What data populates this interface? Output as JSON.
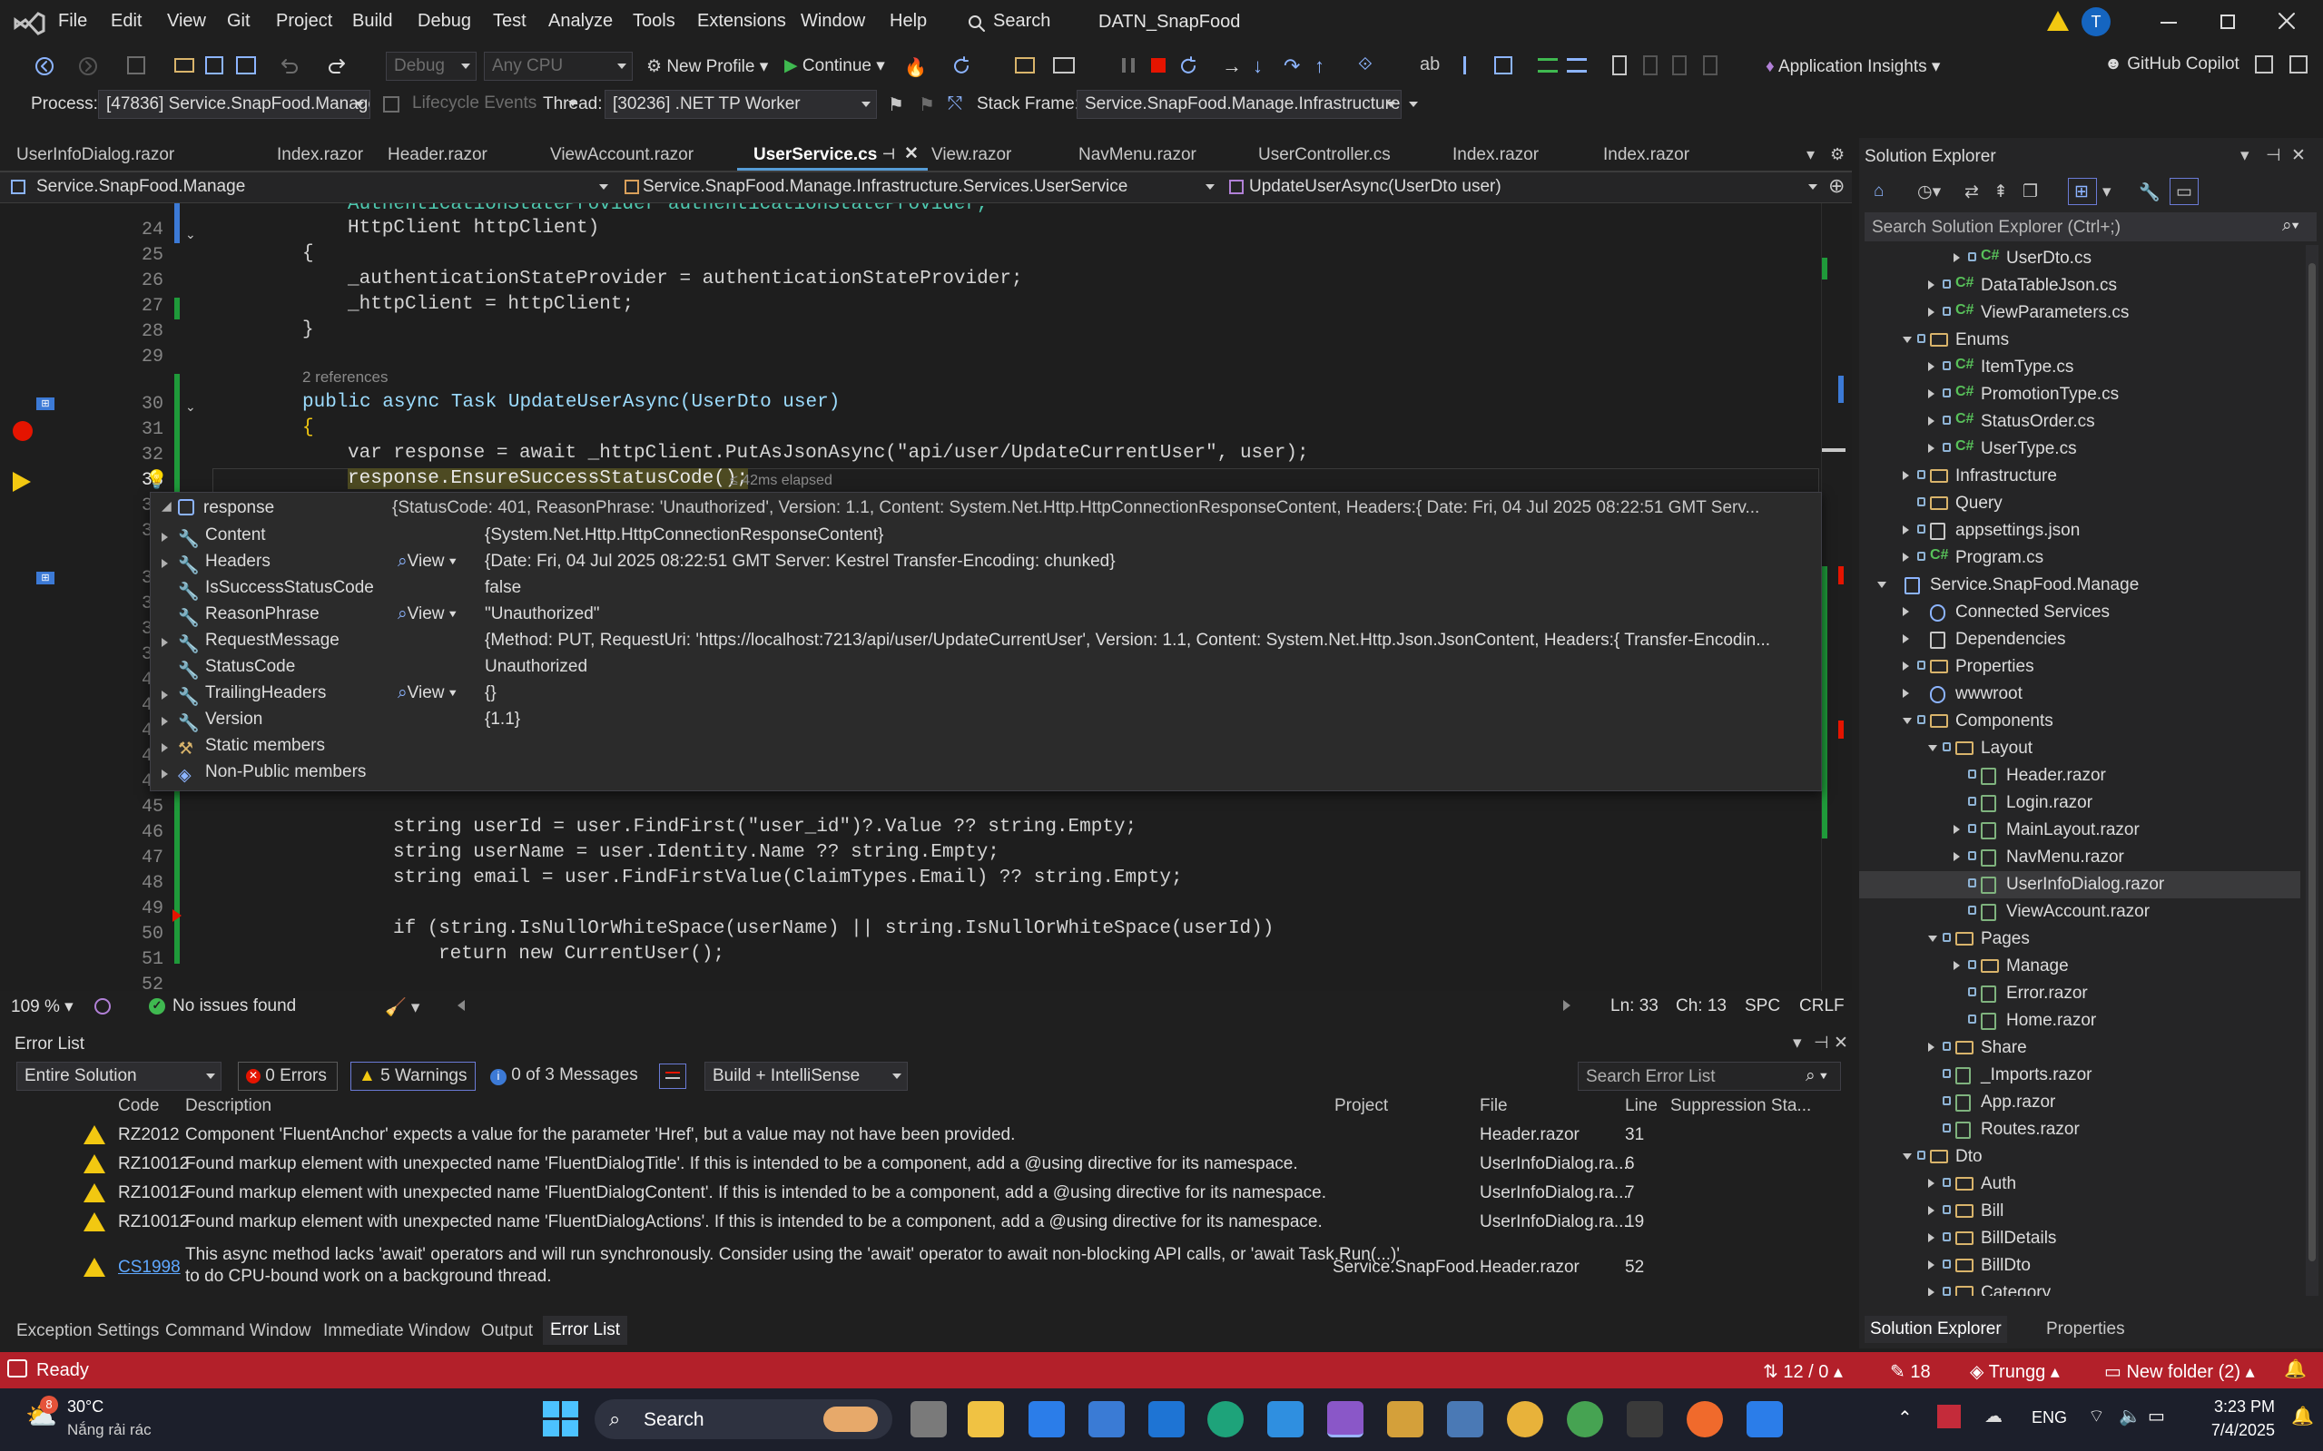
{
  "app": {
    "logo": "visual-studio-logo-icon",
    "solution_name": "DATN_SnapFood",
    "avatar_initial": "T",
    "search_label": "Search"
  },
  "menu": [
    "File",
    "Edit",
    "View",
    "Git",
    "Project",
    "Build",
    "Debug",
    "Test",
    "Analyze",
    "Tools",
    "Extensions",
    "Window",
    "Help"
  ],
  "toolbar": {
    "config": "Debug",
    "platform": "Any CPU",
    "profile": "New Profile",
    "continue": "Continue",
    "insights": "Application Insights",
    "copilot": "GitHub Copilot"
  },
  "debugbar": {
    "process_label": "Process:",
    "process": "[47836] Service.SnapFood.Manage",
    "lifecycle": "Lifecycle Events",
    "thread_label": "Thread:",
    "thread": "[30236] .NET TP Worker",
    "stack_label": "Stack Frame:",
    "stack": "Service.SnapFood.Manage.Infrastructure.S"
  },
  "tabs": [
    "UserInfoDialog.razor",
    "Index.razor",
    "Header.razor",
    "ViewAccount.razor",
    "UserService.cs",
    "View.razor",
    "NavMenu.razor",
    "UserController.cs",
    "Index.razor",
    "Index.razor"
  ],
  "navbar": {
    "project": "Service.SnapFood.Manage",
    "class": "Service.SnapFood.Manage.Infrastructure.Services.UserService",
    "method": "UpdateUserAsync(UserDto user)"
  },
  "code": {
    "line23": "AuthenticationStateProvider authenticationStateProvider,",
    "line24": "HttpClient httpClient)",
    "line25": "{",
    "line26": "_authenticationStateProvider = authenticationStateProvider;",
    "line27": "_httpClient = httpClient;",
    "line28": "}",
    "refs": "2 references",
    "line30": "public async Task UpdateUserAsync(UserDto user)",
    "line31": "{",
    "line32": "var response = await _httpClient.PutAsJsonAsync(\"api/user/UpdateCurrentUser\", user);",
    "line33": "response.EnsureSuccessStatusCode();",
    "elapsed": "≤ 42ms elapsed",
    "line46": "string userId = user.FindFirst(\"user_id\")?.Value ?? string.Empty;",
    "line47": "string userName = user.Identity.Name ?? string.Empty;",
    "line48": "string email = user.FindFirstValue(ClaimTypes.Email) ?? string.Empty;",
    "line50": "if (string.IsNullOrWhiteSpace(userName) || string.IsNullOrWhiteSpace(userId))",
    "line51": "return new CurrentUser();"
  },
  "line_numbers": [
    "24",
    "25",
    "26",
    "27",
    "28",
    "29",
    "30",
    "31",
    "32",
    "33",
    "34",
    "35",
    "36",
    "37",
    "38",
    "39",
    "40",
    "41",
    "42",
    "43",
    "44",
    "45",
    "46",
    "47",
    "48",
    "49",
    "50",
    "51",
    "52"
  ],
  "tooltip": {
    "header_name": "response",
    "header_value": "{StatusCode: 401, ReasonPhrase: 'Unauthorized', Version: 1.1, Content: System.Net.Http.HttpConnectionResponseContent, Headers:{  Date: Fri, 04 Jul 2025 08:22:51 GMT  Serv...",
    "view_label": "View",
    "rows": [
      {
        "name": "Content",
        "value": "{System.Net.Http.HttpConnectionResponseContent}"
      },
      {
        "name": "Headers",
        "value": "{Date: Fri, 04 Jul 2025 08:22:51 GMT Server: Kestrel Transfer-Encoding: chunked}"
      },
      {
        "name": "IsSuccessStatusCode",
        "value": "false"
      },
      {
        "name": "ReasonPhrase",
        "value": "\"Unauthorized\""
      },
      {
        "name": "RequestMessage",
        "value": "{Method: PUT, RequestUri: 'https://localhost:7213/api/user/UpdateCurrentUser', Version: 1.1, Content: System.Net.Http.Json.JsonContent, Headers:{  Transfer-Encodin..."
      },
      {
        "name": "StatusCode",
        "value": "Unauthorized"
      },
      {
        "name": "TrailingHeaders",
        "value": "{}"
      },
      {
        "name": "Version",
        "value": "{1.1}"
      },
      {
        "name": "Static members",
        "value": ""
      },
      {
        "name": "Non-Public members",
        "value": ""
      }
    ]
  },
  "editor_status": {
    "zoom": "109 %",
    "issues": "No issues found",
    "ln": "Ln: 33",
    "ch": "Ch: 13",
    "spc": "SPC",
    "crlf": "CRLF"
  },
  "error_list": {
    "title": "Error List",
    "scope": "Entire Solution",
    "errors": "0 Errors",
    "warnings": "5 Warnings",
    "messages": "0 of 3 Messages",
    "filter": "Build + IntelliSense",
    "search": "Search Error List",
    "cols": {
      "code": "Code",
      "desc": "Description",
      "project": "Project",
      "file": "File",
      "line": "Line",
      "supp": "Suppression Sta..."
    },
    "rows": [
      {
        "code": "RZ2012",
        "desc": "Component 'FluentAnchor' expects a value for the parameter 'Href', but a value may not have been provided.",
        "project": "",
        "file": "Header.razor",
        "line": "31"
      },
      {
        "code": "RZ10012",
        "desc": "Found markup element with unexpected name 'FluentDialogTitle'. If this is intended to be a component, add a @using directive for its namespace.",
        "project": "",
        "file": "UserInfoDialog.ra...",
        "line": "6"
      },
      {
        "code": "RZ10012",
        "desc": "Found markup element with unexpected name 'FluentDialogContent'. If this is intended to be a component, add a @using directive for its namespace.",
        "project": "",
        "file": "UserInfoDialog.ra...",
        "line": "7"
      },
      {
        "code": "RZ10012",
        "desc": "Found markup element with unexpected name 'FluentDialogActions'. If this is intended to be a component, add a @using directive for its namespace.",
        "project": "",
        "file": "UserInfoDialog.ra...",
        "line": "19"
      },
      {
        "code": "CS1998",
        "desc": "This async method lacks 'await' operators and will run synchronously. Consider using the 'await' operator to await non-blocking API calls, or 'await Task.Run(...)'",
        "desc2": "to do CPU-bound work on a background thread.",
        "project": "Service.SnapFood...",
        "file": "Header.razor",
        "line": "52"
      }
    ]
  },
  "bottom_tabs": [
    "Exception Settings",
    "Command Window",
    "Immediate Window",
    "Output",
    "Error List"
  ],
  "solution_explorer": {
    "title": "Solution Explorer",
    "search": "Search Solution Explorer (Ctrl+;)",
    "items": [
      {
        "label": "UserDto.cs",
        "kind": "cs",
        "indent": 3
      },
      {
        "label": "DataTableJson.cs",
        "kind": "cs",
        "indent": 2
      },
      {
        "label": "ViewParameters.cs",
        "kind": "cs",
        "indent": 2
      },
      {
        "label": "Enums",
        "kind": "folder",
        "indent": 1,
        "open": true
      },
      {
        "label": "ItemType.cs",
        "kind": "cs",
        "indent": 2
      },
      {
        "label": "PromotionType.cs",
        "kind": "cs",
        "indent": 2
      },
      {
        "label": "StatusOrder.cs",
        "kind": "cs",
        "indent": 2
      },
      {
        "label": "UserType.cs",
        "kind": "cs",
        "indent": 2
      },
      {
        "label": "Infrastructure",
        "kind": "folder",
        "indent": 1
      },
      {
        "label": "Query",
        "kind": "folder",
        "indent": 1,
        "leaf": true
      },
      {
        "label": "appsettings.json",
        "kind": "json",
        "indent": 1
      },
      {
        "label": "Program.cs",
        "kind": "cs",
        "indent": 1
      },
      {
        "label": "Service.SnapFood.Manage",
        "kind": "project",
        "indent": 0,
        "open": true
      },
      {
        "label": "Connected Services",
        "kind": "service",
        "indent": 1
      },
      {
        "label": "Dependencies",
        "kind": "deps",
        "indent": 1
      },
      {
        "label": "Properties",
        "kind": "props",
        "indent": 1
      },
      {
        "label": "wwwroot",
        "kind": "globe",
        "indent": 1
      },
      {
        "label": "Components",
        "kind": "folder",
        "indent": 1,
        "open": true
      },
      {
        "label": "Layout",
        "kind": "folder",
        "indent": 2,
        "open": true
      },
      {
        "label": "Header.razor",
        "kind": "razor",
        "indent": 3,
        "leaf": true
      },
      {
        "label": "Login.razor",
        "kind": "razor",
        "indent": 3,
        "leaf": true
      },
      {
        "label": "MainLayout.razor",
        "kind": "razor",
        "indent": 3
      },
      {
        "label": "NavMenu.razor",
        "kind": "razor",
        "indent": 3
      },
      {
        "label": "UserInfoDialog.razor",
        "kind": "razor",
        "indent": 3,
        "leaf": true,
        "selected": true
      },
      {
        "label": "ViewAccount.razor",
        "kind": "razor",
        "indent": 3,
        "leaf": true
      },
      {
        "label": "Pages",
        "kind": "folder",
        "indent": 2,
        "open": true
      },
      {
        "label": "Manage",
        "kind": "folder",
        "indent": 3
      },
      {
        "label": "Error.razor",
        "kind": "razor",
        "indent": 3,
        "leaf": true
      },
      {
        "label": "Home.razor",
        "kind": "razor",
        "indent": 3,
        "leaf": true
      },
      {
        "label": "Share",
        "kind": "folder",
        "indent": 2
      },
      {
        "label": "_Imports.razor",
        "kind": "razor",
        "indent": 2,
        "leaf": true
      },
      {
        "label": "App.razor",
        "kind": "razor",
        "indent": 2,
        "leaf": true
      },
      {
        "label": "Routes.razor",
        "kind": "razor",
        "indent": 2,
        "leaf": true
      },
      {
        "label": "Dto",
        "kind": "folder",
        "indent": 1,
        "open": true
      },
      {
        "label": "Auth",
        "kind": "folder",
        "indent": 2
      },
      {
        "label": "Bill",
        "kind": "folder",
        "indent": 2
      },
      {
        "label": "BillDetails",
        "kind": "folder",
        "indent": 2
      },
      {
        "label": "BillDto",
        "kind": "folder",
        "indent": 2
      },
      {
        "label": "Category",
        "kind": "folder",
        "indent": 2
      }
    ],
    "tab_solution": "Solution Explorer",
    "tab_properties": "Properties"
  },
  "statusbar": {
    "ready": "Ready",
    "git_changes": "12 / 0",
    "edits": "18",
    "user": "Trungg",
    "branch": "New folder (2)"
  },
  "taskbar": {
    "weather_temp": "30°C",
    "weather_desc": "Nắng rải rác",
    "weather_badge": "8",
    "search": "Search",
    "lang": "ENG",
    "time": "3:23 PM",
    "date": "7/4/2025"
  },
  "colors": {
    "accent": "#569cd6",
    "statusbar": "#b3202a",
    "warning": "#f2c811",
    "breakpoint": "#e51400"
  }
}
